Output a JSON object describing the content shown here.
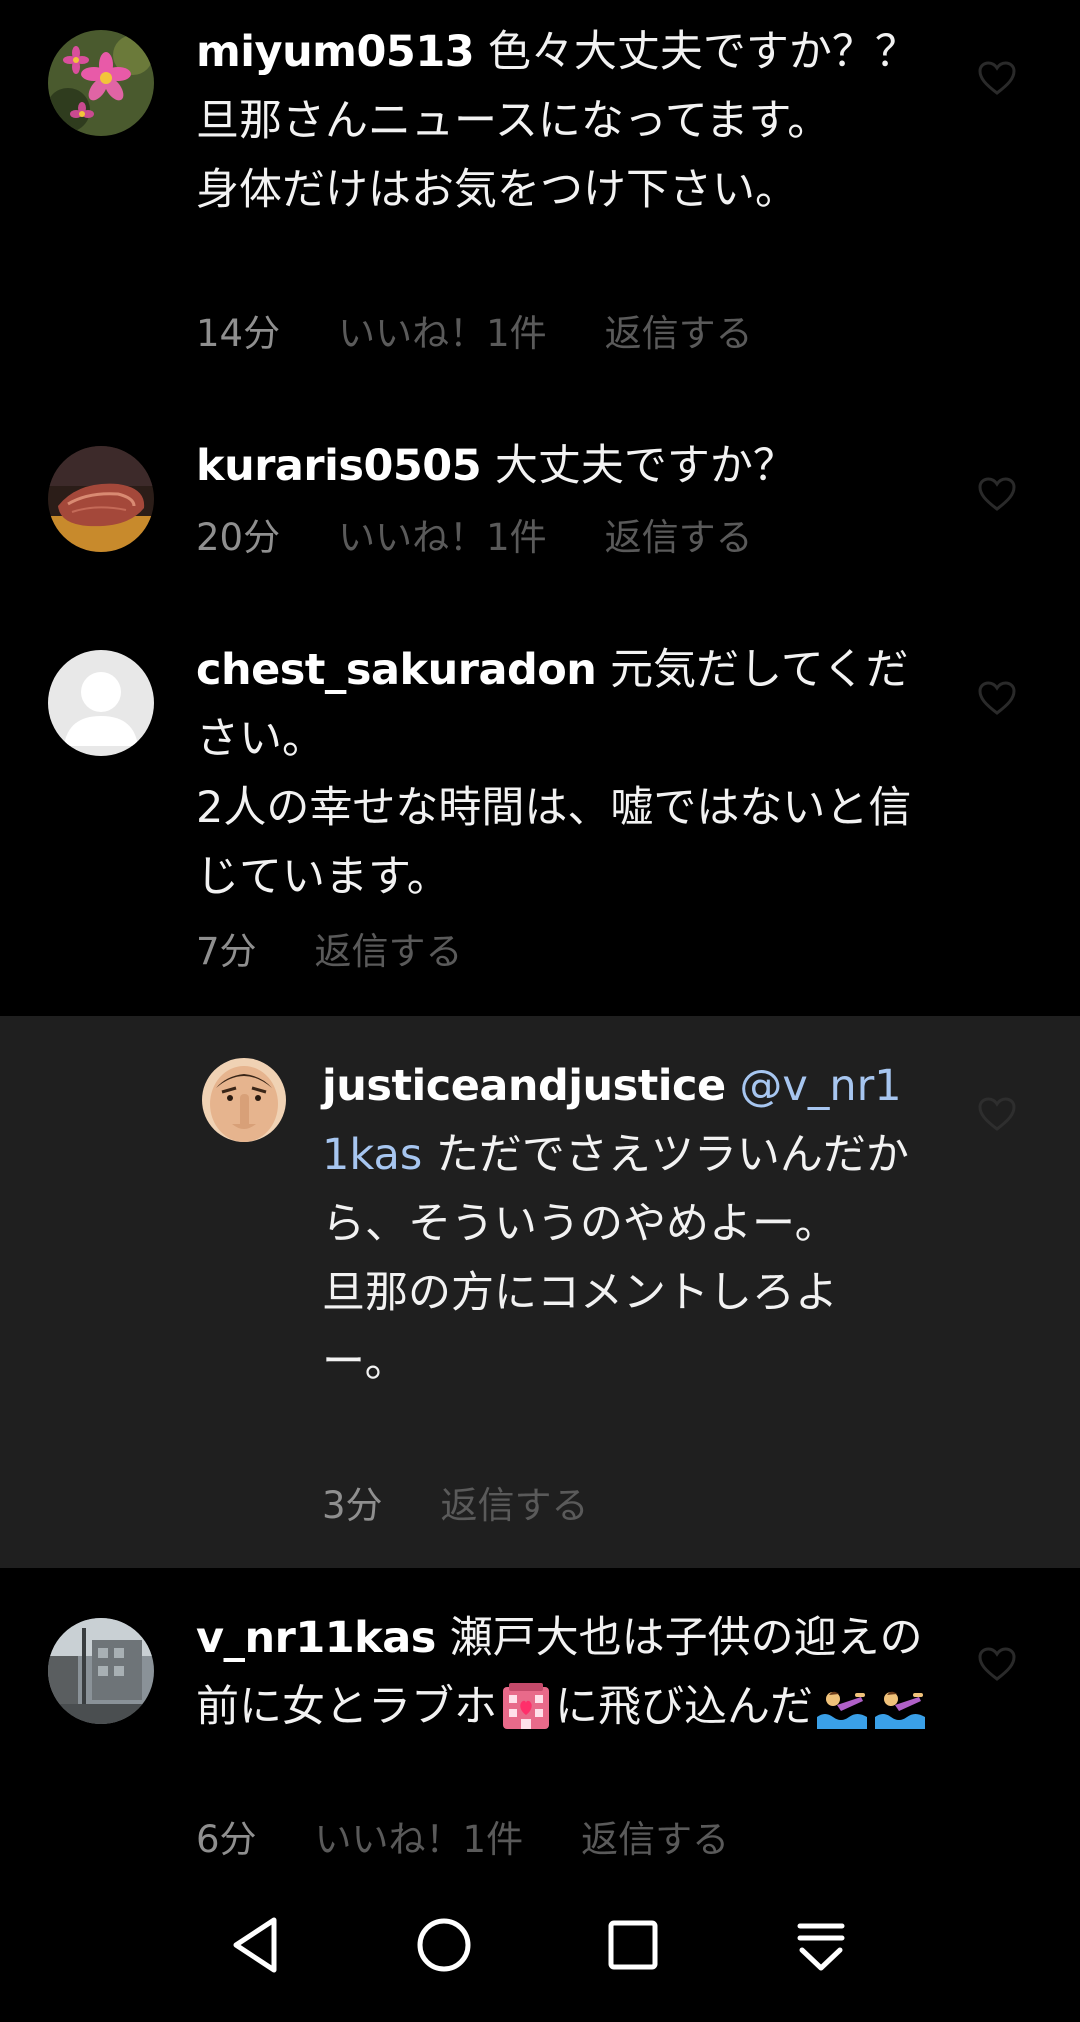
{
  "comments": [
    {
      "username": "miyum0513",
      "text": " 色々大丈夫ですか？？\n旦那さんニュースになってます。\n身体だけはお気をつけ下さい。",
      "time": "14分",
      "likes": "いいね！1件",
      "reply": "返信する",
      "avatar_icon": "cosmos-flower-avatar"
    },
    {
      "username": "kuraris0505",
      "text": " 大丈夫ですか？",
      "time": "20分",
      "likes": "いいね！1件",
      "reply": "返信する",
      "avatar_icon": "steak-avatar"
    },
    {
      "username": "chest_sakuradon",
      "text": " 元気だしてください。\n2人の幸せな時間は、嘘ではないと信じています。",
      "time": "7分",
      "reply": "返信する",
      "avatar_icon": "default-person-avatar"
    },
    {
      "username": "justiceandjustice",
      "mention": " @v_nr11kas",
      "text": " ただでさえツラいんだから、そういうのやめよー。\n旦那の方にコメントしろよー。",
      "time": "3分",
      "reply": "返信する",
      "avatar_icon": "shushing-face-avatar"
    },
    {
      "username": "v_nr11kas",
      "text_before": " 瀬戸大也は子供の迎えの前に女とラブホ",
      "text_after": "に飛び込んだ",
      "emoji_icons": [
        "love-hotel-icon",
        "swimmer-icon",
        "swimmer-icon"
      ],
      "time": "6分",
      "likes": "いいね！1件",
      "reply": "返信する",
      "avatar_icon": "street-photo-avatar"
    }
  ],
  "navigation": {
    "back_icon": "back-triangle-icon",
    "home_icon": "home-circle-icon",
    "recents_icon": "recents-square-icon",
    "notification_icon": "notification-pulldown-icon"
  },
  "colors": {
    "background": "#000000",
    "reply_background": "#1f1f1f",
    "text": "#f2f2f2",
    "meta_text": "#8f8f8f",
    "dim_text": "#5a5a5a",
    "mention": "#a7c6f0"
  }
}
